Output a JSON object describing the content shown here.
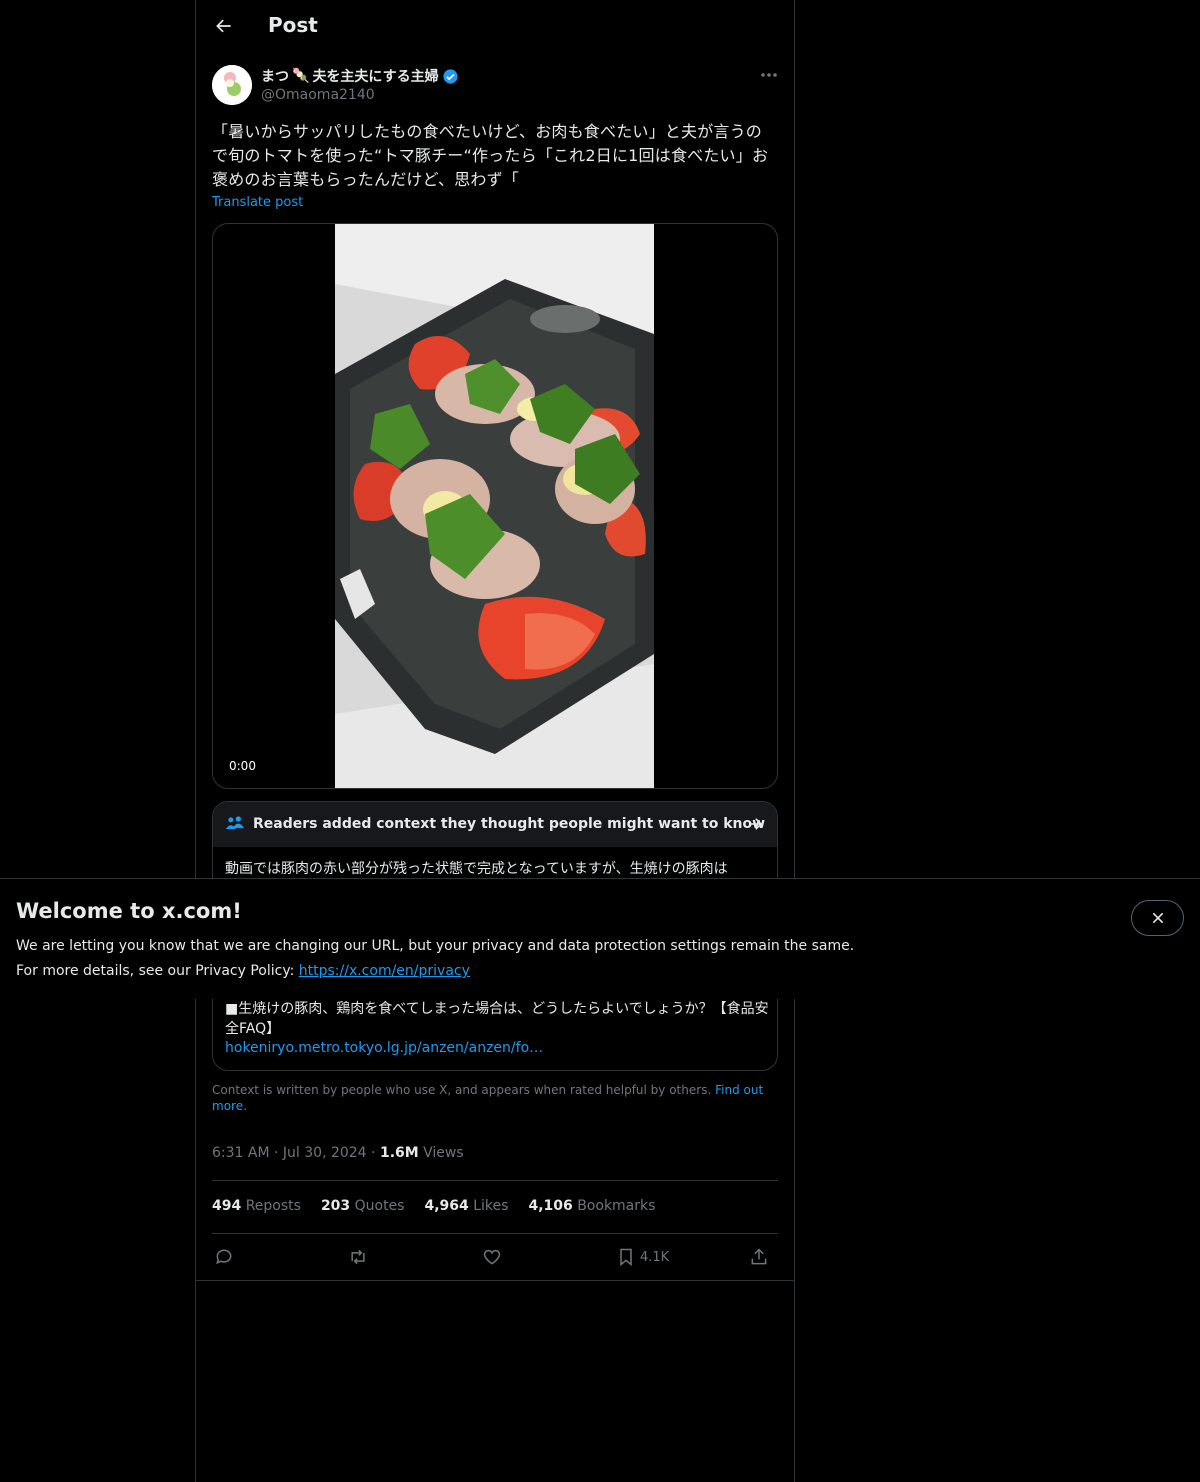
{
  "header": {
    "title": "Post"
  },
  "author": {
    "name_prefix": "まつ",
    "name_suffix": "夫を主夫にする主婦",
    "handle": "@Omaoma2140"
  },
  "post": {
    "text": "「暑いからサッパリしたもの食べたいけど、お肉も食べたい」と夫が言うので旬のトマトを使った“トマ豚チー“作ったら「これ2日に1回は食べたい」お褒めのお言葉もらったんだけど、思わず「",
    "translate_label": "Translate post",
    "video_time": "0:00"
  },
  "community_note": {
    "title": "Readers added context they thought people might want to know",
    "body": "動画では豚肉の赤い部分が残った状態で完成となっていますが、生焼けの豚肉は",
    "link_title": "■生焼けの豚肉、鶏肉を食べてしまった場合は、どうしたらよいでしょうか？【食品安全FAQ】",
    "link_url": "hokeniryo.metro.tokyo.lg.jp/anzen/anzen/fo…",
    "footer_text": "Context is written by people who use X, and appears when rated helpful by others.",
    "footer_link": "Find out more."
  },
  "meta": {
    "time": "6:31 AM",
    "date": "Jul 30, 2024",
    "views_count": "1.6M",
    "views_label": "Views"
  },
  "stats": {
    "reposts_count": "494",
    "reposts_label": "Reposts",
    "quotes_count": "203",
    "quotes_label": "Quotes",
    "likes_count": "4,964",
    "likes_label": "Likes",
    "bookmarks_count": "4,106",
    "bookmarks_label": "Bookmarks"
  },
  "actions": {
    "bookmark_count": "4.1K"
  },
  "banner": {
    "title": "Welcome to x.com!",
    "line1": "We are letting you know that we are changing our URL, but your privacy and data protection settings remain the same.",
    "line2_prefix": "For more details, see our Privacy Policy: ",
    "link": "https://x.com/en/privacy"
  },
  "colors": {
    "accent": "#1d9bf0",
    "muted": "#71767b",
    "border": "#2f3336"
  }
}
